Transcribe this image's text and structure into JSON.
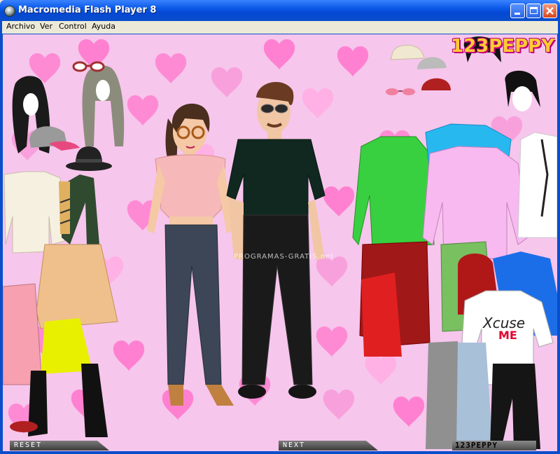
{
  "window": {
    "title": "Macromedia Flash Player 8",
    "buttons": {
      "minimize": "minimize",
      "maximize": "maximize",
      "close": "close"
    }
  },
  "menu": [
    {
      "label": "Archivo"
    },
    {
      "label": "Ver"
    },
    {
      "label": "Control"
    },
    {
      "label": "Ayuda"
    }
  ],
  "game": {
    "logo": "123PEPPY",
    "watermark": "PROGRAMAS-GRATIS.net",
    "reset_label": "RESET",
    "next_label": "NEXT",
    "brand_label": "123PEPPY",
    "shirt_text_line1": "Xcuse",
    "shirt_text_line2": "ME",
    "colors": {
      "background": "#f6c6ec",
      "heart": "#ff7ad0",
      "accent": "#e0007a"
    }
  }
}
